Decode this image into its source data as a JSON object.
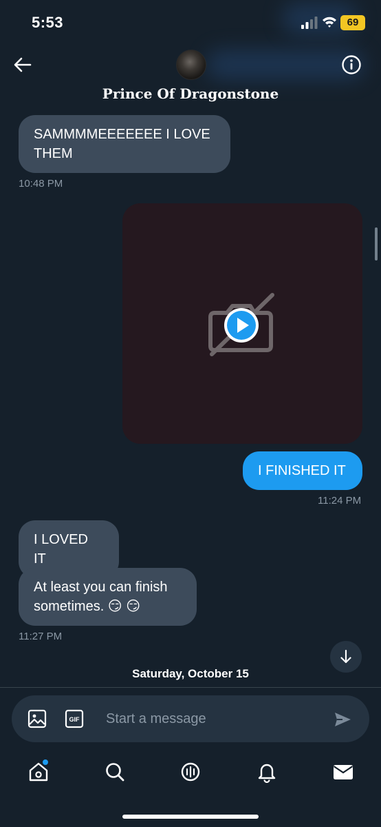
{
  "status_bar": {
    "time": "5:53",
    "battery": "69"
  },
  "header": {
    "contact_name": "Prince Of Dragonstone"
  },
  "messages": [
    {
      "direction": "received",
      "text": "SAMMMMEEEEEEE I LOVE THEM",
      "time": "10:48 PM"
    },
    {
      "direction": "sent",
      "type": "video"
    },
    {
      "direction": "sent",
      "text": "I FINISHED IT",
      "time": "11:24 PM"
    },
    {
      "direction": "received",
      "text": "I LOVED IT"
    },
    {
      "direction": "received",
      "text": "At least you can finish sometimes. 😏 😏",
      "time": "11:27 PM"
    }
  ],
  "date_separator": "Saturday, October 15",
  "composer": {
    "placeholder": "Start a message",
    "gif_label": "GIF"
  },
  "nav": {
    "items": [
      "home-icon",
      "search-icon",
      "spaces-icon",
      "notifications-icon",
      "messages-icon"
    ],
    "home_has_badge": true
  },
  "colors": {
    "background": "#15202b",
    "received_bubble": "#3d4b5b",
    "sent_bubble": "#1d9bf0",
    "battery": "#f3c623"
  }
}
